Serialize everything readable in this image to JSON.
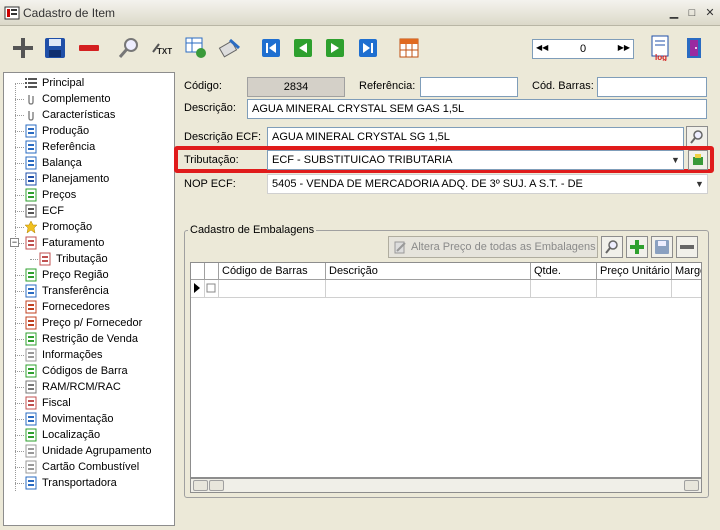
{
  "window": {
    "title": "Cadastro de Item"
  },
  "nav": {
    "record": "0"
  },
  "tree": {
    "items": [
      {
        "label": "Principal",
        "icon": "list-icon"
      },
      {
        "label": "Complemento",
        "icon": "paperclip-icon"
      },
      {
        "label": "Características",
        "icon": "paperclip-icon"
      },
      {
        "label": "Produção",
        "icon": "production-icon"
      },
      {
        "label": "Referência",
        "icon": "reference-icon"
      },
      {
        "label": "Balança",
        "icon": "scale-icon"
      },
      {
        "label": "Planejamento",
        "icon": "planning-icon"
      },
      {
        "label": "Preços",
        "icon": "prices-icon"
      },
      {
        "label": "ECF",
        "icon": "printer-icon"
      },
      {
        "label": "Promoção",
        "icon": "star-icon"
      },
      {
        "label": "Faturamento",
        "icon": "billing-icon"
      },
      {
        "label": "Tributação",
        "icon": "tax-icon"
      },
      {
        "label": "Preço Região",
        "icon": "region-price-icon"
      },
      {
        "label": "Transferência",
        "icon": "transfer-icon"
      },
      {
        "label": "Fornecedores",
        "icon": "suppliers-icon"
      },
      {
        "label": "Preço p/ Fornecedor",
        "icon": "supplier-price-icon"
      },
      {
        "label": "Restrição de Venda",
        "icon": "restriction-icon"
      },
      {
        "label": "Informações",
        "icon": "info-icon"
      },
      {
        "label": "Códigos de Barra",
        "icon": "barcode-icon"
      },
      {
        "label": "RAM/RCM/RAC",
        "icon": "ram-icon"
      },
      {
        "label": "Fiscal",
        "icon": "fiscal-icon"
      },
      {
        "label": "Movimentação",
        "icon": "movement-icon"
      },
      {
        "label": "Localização",
        "icon": "location-icon"
      },
      {
        "label": "Unidade Agrupamento",
        "icon": "unit-icon"
      },
      {
        "label": "Cartão Combustível",
        "icon": "fuel-card-icon"
      },
      {
        "label": "Transportadora",
        "icon": "truck-icon"
      }
    ]
  },
  "form": {
    "codigo_label": "Código:",
    "codigo_value": "2834",
    "referencia_label": "Referência:",
    "referencia_value": "",
    "cod_barras_label": "Cód. Barras:",
    "cod_barras_value": "",
    "descricao_label": "Descrição:",
    "descricao_value": "AGUA MINERAL CRYSTAL SEM GAS 1,5L",
    "descricao_ecf_label": "Descrição ECF:",
    "descricao_ecf_value": "AGUA MINERAL CRYSTAL SG 1,5L",
    "tributacao_label": "Tributação:",
    "tributacao_value": "ECF - SUBSTITUICAO TRIBUTARIA",
    "nop_ecf_label": "NOP ECF:",
    "nop_ecf_value": "5405 - VENDA DE MERCADORIA ADQ. DE 3º SUJ. A S.T. - DE"
  },
  "embalagens": {
    "title": "Cadastro de Embalagens",
    "altera_preco_label": "Altera Preço de todas as Embalagens",
    "columns": [
      "Código de Barras",
      "Descrição",
      "Qtde.",
      "Preço Unitário",
      "Marge"
    ]
  },
  "colors": {
    "highlight": "#e01b1b",
    "window_bg": "#ece9d8"
  }
}
